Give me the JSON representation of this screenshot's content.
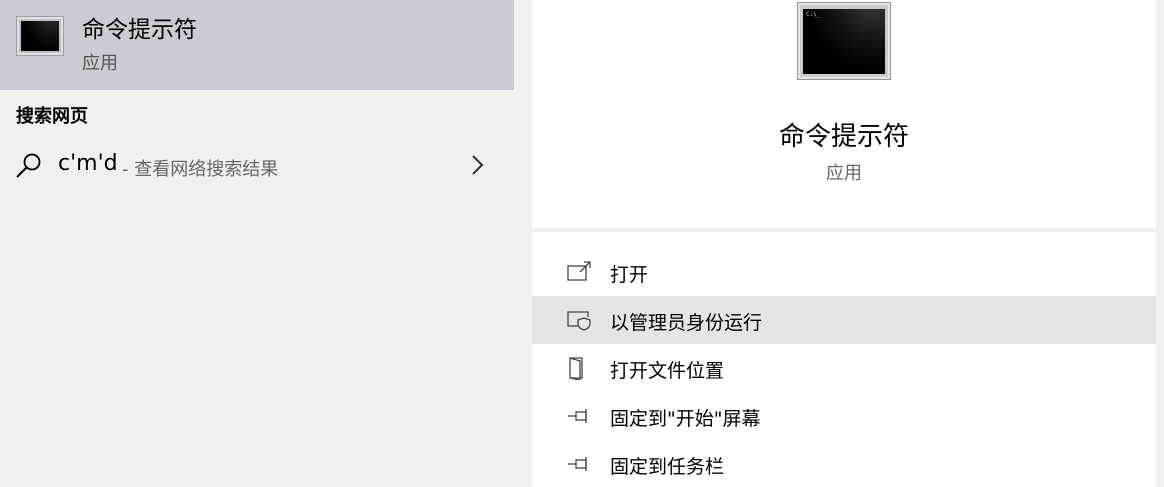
{
  "best_match": {
    "title": "命令提示符",
    "subtitle": "应用",
    "icon": "cmd-app-icon",
    "background": "#c9ccd3"
  },
  "web_section": {
    "heading": "搜索网页",
    "query": "c'm'd",
    "suffix": "- 查看网络搜索结果",
    "icon": "search-icon"
  },
  "detail": {
    "title": "命令提示符",
    "subtitle": "应用",
    "icon_prompt": "C:\\_"
  },
  "actions": [
    {
      "label": "打开",
      "icon": "open-icon"
    },
    {
      "label": "以管理员身份运行",
      "icon": "run-as-admin-icon"
    },
    {
      "label": "打开文件位置",
      "icon": "file-location-icon"
    },
    {
      "label": "固定到\"开始\"屏幕",
      "icon": "pin-icon"
    },
    {
      "label": "固定到任务栏",
      "icon": "pin-icon"
    }
  ],
  "colors": {
    "pane_bg": "#f0f0f0",
    "hover_bg": "#e5e5e5",
    "detail_bg": "#ffffff"
  }
}
